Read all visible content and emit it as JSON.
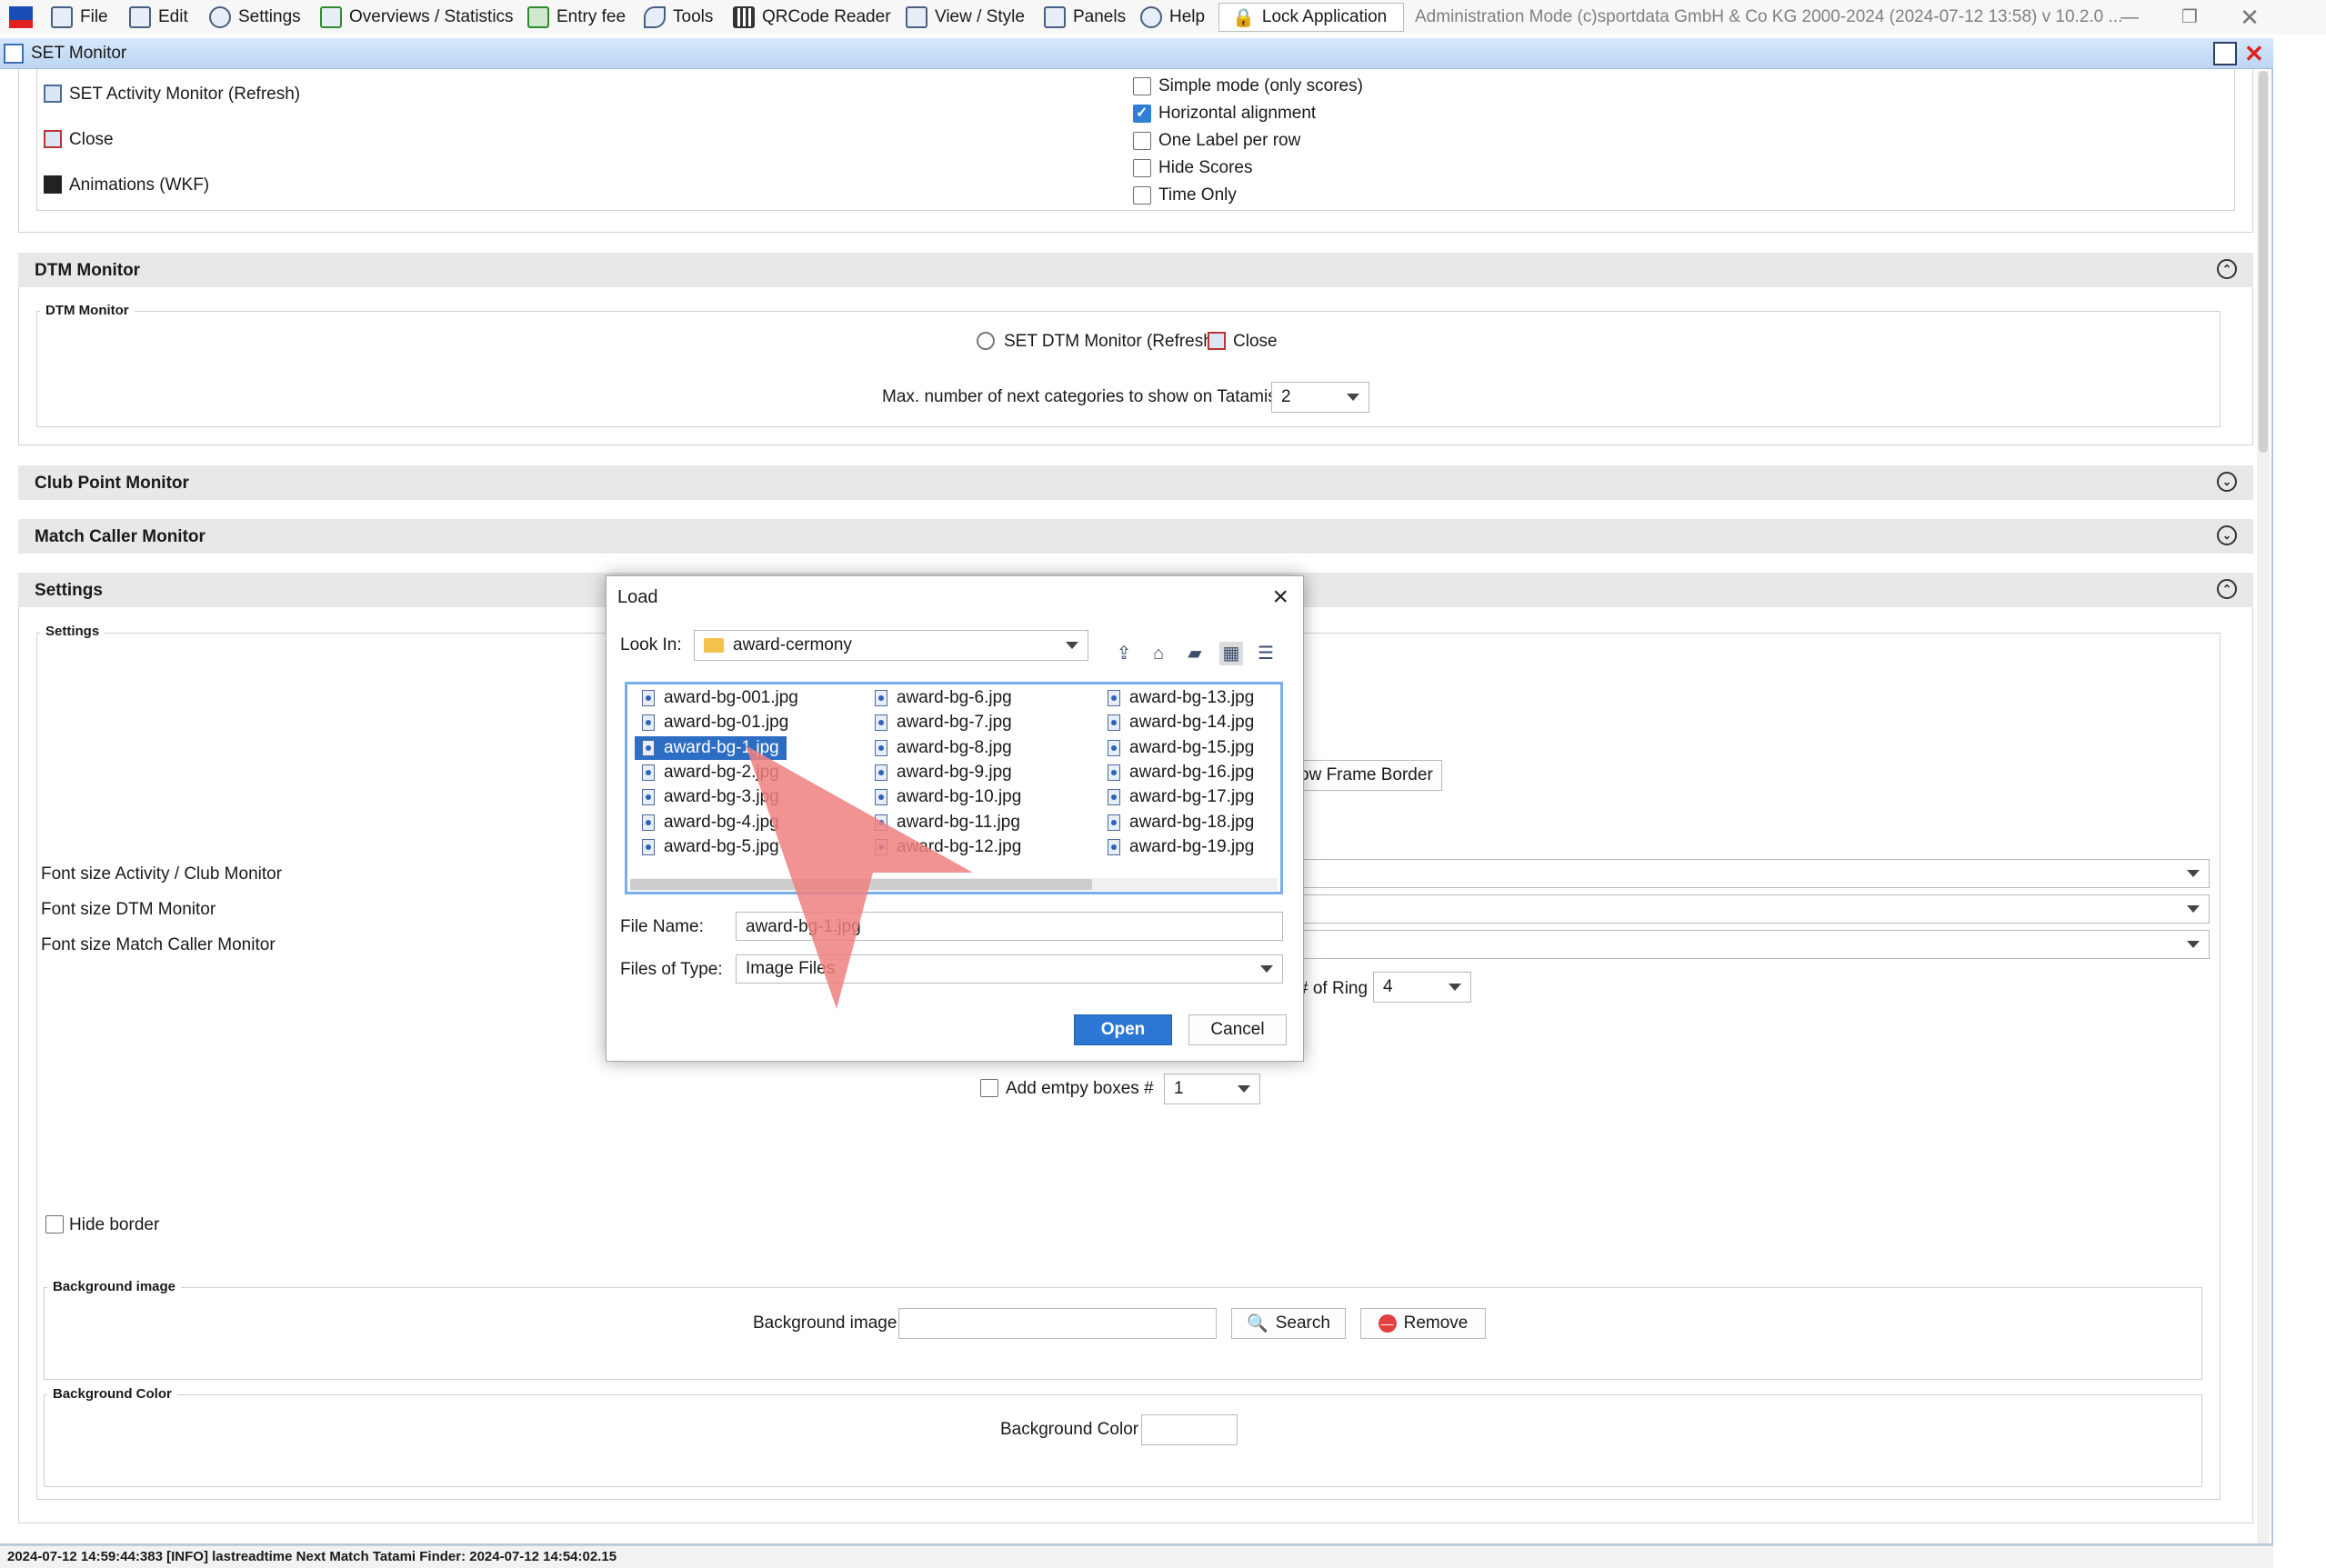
{
  "menubar": {
    "items": [
      {
        "label": "File",
        "icon": "folder-icon"
      },
      {
        "label": "Edit",
        "icon": "edit-icon"
      },
      {
        "label": "Settings",
        "icon": "gear-icon"
      },
      {
        "label": "Overviews / Statistics",
        "icon": "chart-icon"
      },
      {
        "label": "Entry fee",
        "icon": "money-icon"
      },
      {
        "label": "Tools",
        "icon": "wrench-icon"
      },
      {
        "label": "QRCode Reader",
        "icon": "qrcode-icon"
      },
      {
        "label": "View / Style",
        "icon": "view-icon"
      },
      {
        "label": "Panels",
        "icon": "panels-icon"
      },
      {
        "label": "Help",
        "icon": "help-icon"
      }
    ],
    "lock_label": "Lock Application",
    "admin_text": "Administration Mode (c)sportdata GmbH & Co KG 2000-2024 (2024-07-12 13:58)  v 10.2.0 ..."
  },
  "frame": {
    "title": "SET Monitor"
  },
  "top_section": {
    "links": [
      {
        "label": "SET Activity Monitor (Refresh)",
        "icon": "monitor-icon"
      },
      {
        "label": "Close",
        "icon": "close-window-icon"
      },
      {
        "label": "Animations (WKF)",
        "icon": "animation-icon"
      }
    ],
    "options": [
      {
        "label": "Simple mode (only scores)",
        "checked": false
      },
      {
        "label": "Horizontal alignment",
        "checked": true
      },
      {
        "label": "One Label per row",
        "checked": false
      },
      {
        "label": "Hide Scores",
        "checked": false
      },
      {
        "label": "Time Only",
        "checked": false
      }
    ]
  },
  "dtm_section": {
    "header": "DTM Monitor",
    "group_label": "DTM Monitor",
    "refresh_label": "SET DTM Monitor (Refresh)",
    "close_label": "Close",
    "next_categories_label": "Max. number of next categories to show on Tatamis:",
    "next_categories_value": "2"
  },
  "club_section": {
    "header": "Club Point Monitor"
  },
  "caller_section": {
    "header": "Match Caller Monitor"
  },
  "settings_section": {
    "header": "Settings",
    "group_label": "Settings",
    "frame_border_label": "ow Frame Border",
    "font_size_activity_label": "Font size Activity / Club Monitor",
    "font_size_dtm_label": "Font size DTM Monitor",
    "font_size_caller_label": "Font size Match Caller Monitor",
    "ring_label": "# of Ring",
    "ring_value": "4",
    "empty_boxes_label": "Add emtpy boxes",
    "empty_boxes_hash": "#",
    "empty_boxes_value": "1",
    "hide_border_label": "Hide border",
    "bg_image_group": "Background image",
    "bg_image_label": "Background image",
    "search_label": "Search",
    "remove_label": "Remove",
    "bg_color_group": "Background Color",
    "bg_color_label": "Background Color"
  },
  "dialog": {
    "title": "Load",
    "look_in_label": "Look In:",
    "look_in_value": "award-cermony",
    "files": [
      "award-bg-001.jpg",
      "award-bg-01.jpg",
      "award-bg-1.jpg",
      "award-bg-2.jpg",
      "award-bg-3.jpg",
      "award-bg-4.jpg",
      "award-bg-5.jpg",
      "award-bg-6.jpg",
      "award-bg-7.jpg",
      "award-bg-8.jpg",
      "award-bg-9.jpg",
      "award-bg-10.jpg",
      "award-bg-11.jpg",
      "award-bg-12.jpg",
      "award-bg-13.jpg",
      "award-bg-14.jpg",
      "award-bg-15.jpg",
      "award-bg-16.jpg",
      "award-bg-17.jpg",
      "award-bg-18.jpg",
      "award-bg-19.jpg"
    ],
    "selected_file": "award-bg-1.jpg",
    "file_name_label": "File Name:",
    "file_name_value": "award-bg-1.jpg",
    "files_of_type_label": "Files of Type:",
    "files_of_type_value": "Image Files",
    "open_label": "Open",
    "cancel_label": "Cancel"
  },
  "status": {
    "text": "2024-07-12 14:59:44:383 [INFO] lastreadtime Next Match Tatami Finder: 2024-07-12 14:54:02.15"
  },
  "colors": {
    "accent": "#2d77d4",
    "selection": "#2d6dc4",
    "pointer_arrow": "#f08080",
    "close_red": "#e02020"
  }
}
